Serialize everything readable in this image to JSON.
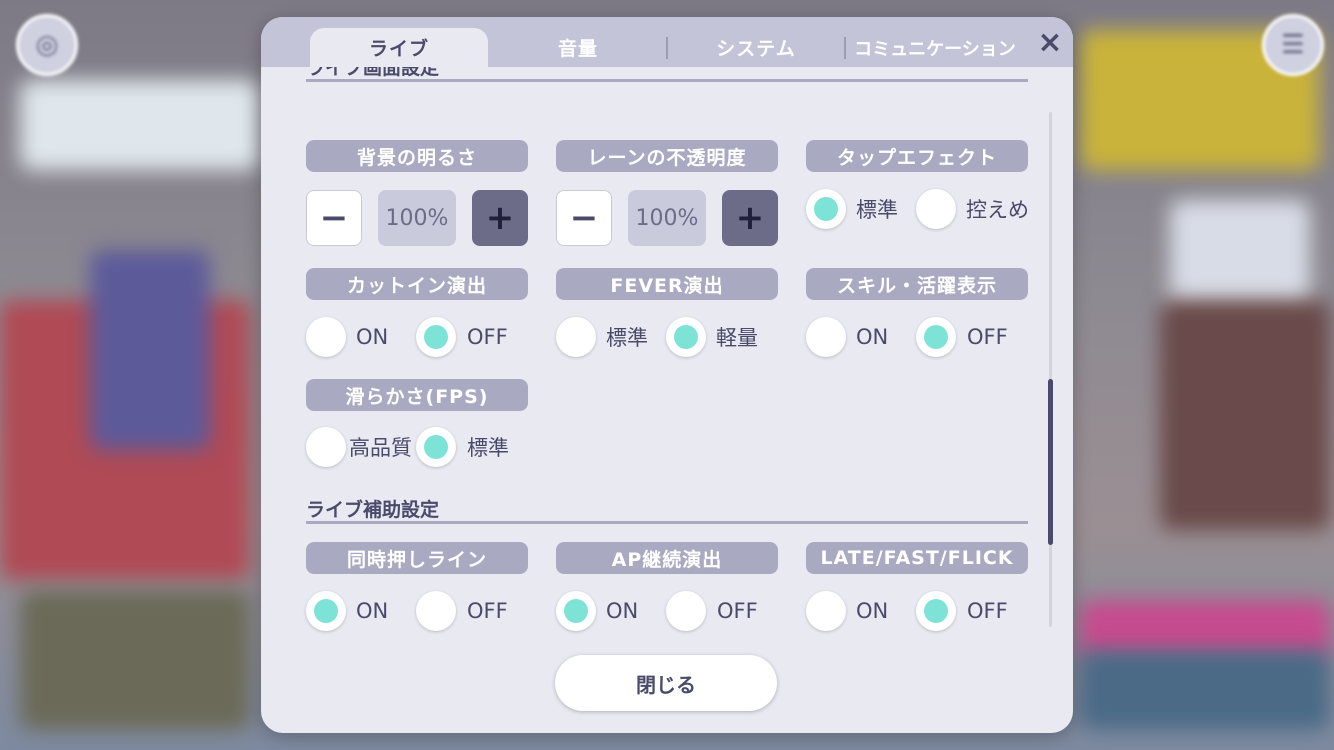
{
  "tabs": [
    "ライブ",
    "音量",
    "システム",
    "コミュニケーション"
  ],
  "active_tab": "ライブ",
  "close_icon": "×",
  "section_partial_title": "ライブ画面設定",
  "stepper_minus": "−",
  "stepper_plus": "+",
  "settings": {
    "background_brightness": {
      "label": "背景の明るさ",
      "value": "100%"
    },
    "lane_opacity": {
      "label": "レーンの不透明度",
      "value": "100%"
    },
    "tap_effect": {
      "label": "タップエフェクト",
      "options": [
        "標準",
        "控えめ"
      ],
      "selected": "標準"
    },
    "cut_in": {
      "label": "カットイン演出",
      "options": [
        "ON",
        "OFF"
      ],
      "selected": "OFF"
    },
    "fever": {
      "label": "FEVER演出",
      "options": [
        "標準",
        "軽量"
      ],
      "selected": "軽量"
    },
    "skill_display": {
      "label": "スキル・活躍表示",
      "options": [
        "ON",
        "OFF"
      ],
      "selected": "OFF"
    },
    "fps": {
      "label": "滑らかさ(FPS)",
      "options": [
        "高品質",
        "標準"
      ],
      "selected": "標準"
    }
  },
  "assist_section": {
    "title": "ライブ補助設定",
    "simultaneous_line": {
      "label": "同時押しライン",
      "options": [
        "ON",
        "OFF"
      ],
      "selected": "ON"
    },
    "ap_effect": {
      "label": "AP継続演出",
      "options": [
        "ON",
        "OFF"
      ],
      "selected": "ON"
    },
    "late_fast_flick": {
      "label": "LATE/FAST/FLICK",
      "options": [
        "ON",
        "OFF"
      ],
      "selected": "OFF"
    }
  },
  "close_button": "閉じる",
  "colors": {
    "accent": "#7de3d6",
    "label_bg": "#a9aac1",
    "text": "#4a4a6a",
    "panel": "#e9e9f2"
  }
}
